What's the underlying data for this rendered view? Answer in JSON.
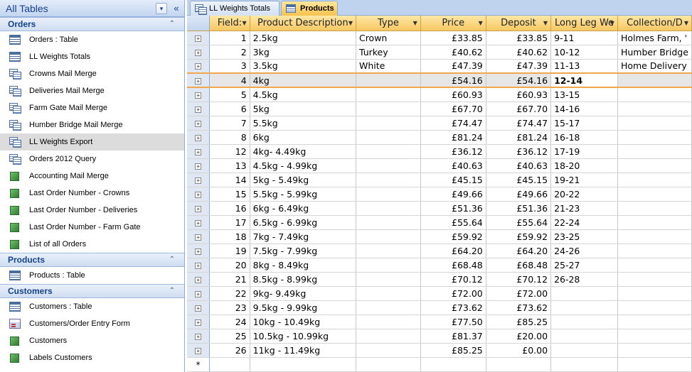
{
  "nav": {
    "title": "All Tables",
    "menu_glyph": "▾",
    "shutter_glyph": "«",
    "collapse_glyph": "⌃",
    "groups": [
      {
        "label": "Orders",
        "items": [
          {
            "label": "Orders : Table",
            "icon": "table"
          },
          {
            "label": "LL Weights Totals",
            "icon": "table"
          },
          {
            "label": "Crowns Mail Merge",
            "icon": "query"
          },
          {
            "label": "Deliveries Mail Merge",
            "icon": "query"
          },
          {
            "label": "Farm Gate Mail Merge",
            "icon": "query"
          },
          {
            "label": "Humber Bridge Mail Merge",
            "icon": "query"
          },
          {
            "label": "LL Weights Export",
            "icon": "query",
            "selected": true
          },
          {
            "label": "Orders 2012 Query",
            "icon": "query"
          },
          {
            "label": "Accounting Mail Merge",
            "icon": "macro"
          },
          {
            "label": "Last Order Number - Crowns",
            "icon": "macro"
          },
          {
            "label": "Last Order Number - Deliveries",
            "icon": "macro"
          },
          {
            "label": "Last Order Number - Farm Gate",
            "icon": "macro"
          },
          {
            "label": "List of all Orders",
            "icon": "macro"
          }
        ]
      },
      {
        "label": "Products",
        "items": [
          {
            "label": "Products : Table",
            "icon": "table"
          }
        ]
      },
      {
        "label": "Customers",
        "items": [
          {
            "label": "Customers : Table",
            "icon": "table"
          },
          {
            "label": "Customers/Order Entry Form",
            "icon": "form"
          },
          {
            "label": "Customers",
            "icon": "macro"
          },
          {
            "label": "Labels Customers",
            "icon": "macro"
          }
        ]
      }
    ]
  },
  "tabs": [
    {
      "label": "LL Weights Totals",
      "active": false
    },
    {
      "label": "Products",
      "active": true
    }
  ],
  "datasheet": {
    "columns": [
      "Field:",
      "Product Description",
      "Type",
      "Price",
      "Deposit",
      "Long Leg We",
      "Collection/D"
    ],
    "expander_glyph": "+",
    "new_row_glyph": "*",
    "rows": [
      [
        "1",
        "2.5kg",
        "Crown",
        "£33.85",
        "£33.85",
        "9-11",
        "Holmes Farm, '"
      ],
      [
        "2",
        "3kg",
        "Turkey",
        "£40.62",
        "£40.62",
        "10-12",
        "Humber Bridge"
      ],
      [
        "3",
        "3.5kg",
        "White",
        "£47.39",
        "£47.39",
        "11-13",
        "Home Delivery"
      ],
      [
        "4",
        "4kg",
        "",
        "£54.16",
        "£54.16",
        "12-14",
        ""
      ],
      [
        "5",
        "4.5kg",
        "",
        "£60.93",
        "£60.93",
        "13-15",
        ""
      ],
      [
        "6",
        "5kg",
        "",
        "£67.70",
        "£67.70",
        "14-16",
        ""
      ],
      [
        "7",
        "5.5kg",
        "",
        "£74.47",
        "£74.47",
        "15-17",
        ""
      ],
      [
        "8",
        "6kg",
        "",
        "£81.24",
        "£81.24",
        "16-18",
        ""
      ],
      [
        "12",
        "4kg- 4.49kg",
        "",
        "£36.12",
        "£36.12",
        "17-19",
        ""
      ],
      [
        "13",
        "4.5kg - 4.99kg",
        "",
        "£40.63",
        "£40.63",
        "18-20",
        ""
      ],
      [
        "14",
        "5kg - 5.49kg",
        "",
        "£45.15",
        "£45.15",
        "19-21",
        ""
      ],
      [
        "15",
        "5.5kg - 5.99kg",
        "",
        "£49.66",
        "£49.66",
        "20-22",
        ""
      ],
      [
        "16",
        "6kg - 6.49kg",
        "",
        "£51.36",
        "£51.36",
        "21-23",
        ""
      ],
      [
        "17",
        "6.5kg - 6.99kg",
        "",
        "£55.64",
        "£55.64",
        "22-24",
        ""
      ],
      [
        "18",
        "7kg - 7.49kg",
        "",
        "£59.92",
        "£59.92",
        "23-25",
        ""
      ],
      [
        "19",
        "7.5kg - 7.99kg",
        "",
        "£64.20",
        "£64.20",
        "24-26",
        ""
      ],
      [
        "20",
        "8kg - 8.49kg",
        "",
        "£68.48",
        "£68.48",
        "25-27",
        ""
      ],
      [
        "21",
        "8.5kg - 8.99kg",
        "",
        "£70.12",
        "£70.12",
        "26-28",
        ""
      ],
      [
        "22",
        "9kg- 9.49kg",
        "",
        "£72.00",
        "£72.00",
        "",
        ""
      ],
      [
        "23",
        "9.5kg - 9.99kg",
        "",
        "£73.62",
        "£73.62",
        "",
        ""
      ],
      [
        "24",
        "10kg - 10.49kg",
        "",
        "£77.50",
        "£85.25",
        "",
        ""
      ],
      [
        "25",
        "10.5kg - 10.99kg",
        "",
        "£81.37",
        "£20.00",
        "",
        ""
      ],
      [
        "26",
        "11kg - 11.49kg",
        "",
        "£85.25",
        "£0.00",
        "",
        ""
      ]
    ],
    "current_row_index": 3
  }
}
